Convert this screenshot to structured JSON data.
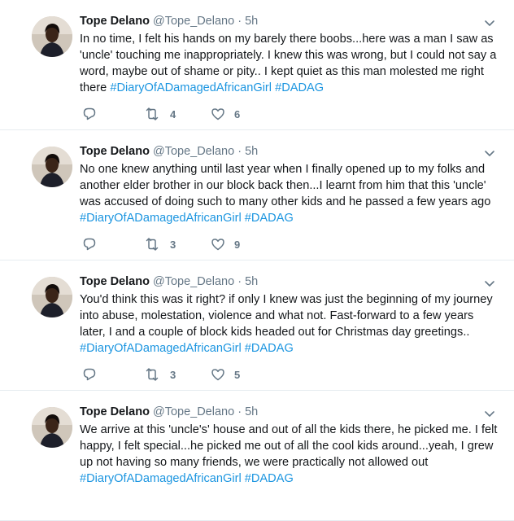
{
  "tweets": [
    {
      "name": "Tope Delano",
      "handle": "@Tope_Delano",
      "sep": "·",
      "time": "5h",
      "text": "In no time, I felt his hands on my barely there boobs...here was a man I saw as 'uncle' touching me inappropriately. I knew this was wrong, but I could not say a word, maybe out of shame or pity.. I kept quiet as this man molested me right there ",
      "hashtags": [
        "#DiaryOfADamagedAfricanGirl",
        "#DADAG"
      ],
      "retweets": "4",
      "likes": "6"
    },
    {
      "name": "Tope Delano",
      "handle": "@Tope_Delano",
      "sep": "·",
      "time": "5h",
      "text": "No one knew anything until last year when I finally opened up to my folks and another elder brother in our block back then...I learnt from him that this 'uncle' was accused of doing such to many other kids and he passed a few years ago ",
      "hashtags": [
        "#DiaryOfADamagedAfricanGirl",
        "#DADAG"
      ],
      "retweets": "3",
      "likes": "9"
    },
    {
      "name": "Tope Delano",
      "handle": "@Tope_Delano",
      "sep": "·",
      "time": "5h",
      "text": "You'd think this was it right? if only I knew was just the beginning of my journey into abuse, molestation, violence and what not. Fast-forward to a few years later, I and a couple of block kids headed out for Christmas day greetings.. ",
      "hashtags": [
        "#DiaryOfADamagedAfricanGirl",
        "#DADAG"
      ],
      "retweets": "3",
      "likes": "5"
    },
    {
      "name": "Tope Delano",
      "handle": "@Tope_Delano",
      "sep": "·",
      "time": "5h",
      "text": "We arrive at this 'uncle's' house and out of all the kids there, he picked me. I felt happy, I felt special...he picked me out of all the cool kids around...yeah, I grew up not having so many friends, we were practically not allowed out ",
      "hashtags": [
        "#DiaryOfADamagedAfricanGirl",
        "#DADAG"
      ],
      "retweets": "",
      "likes": ""
    }
  ],
  "icons": {
    "reply": "reply-icon",
    "retweet": "retweet-icon",
    "like": "heart-icon",
    "caret": "chevron-down-icon"
  },
  "colors": {
    "link": "#1b95e0",
    "muted": "#657786",
    "text": "#14171a",
    "divider": "#e6ecf0"
  }
}
